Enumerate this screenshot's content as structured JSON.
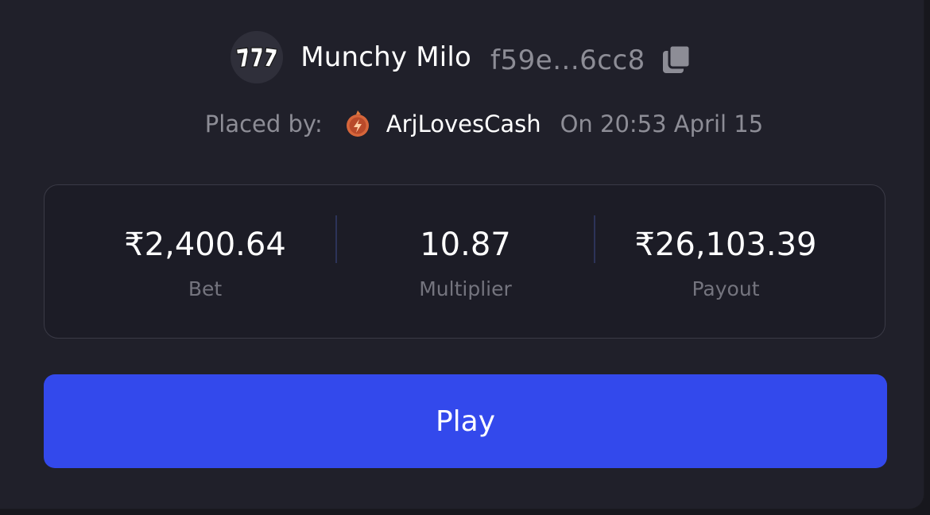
{
  "game": {
    "name": "Munchy Milo",
    "hash": "f59e...6cc8",
    "icon": "slot-777-icon"
  },
  "placed": {
    "label": "Placed by:",
    "username": "ArjLovesCash",
    "user_icon": "lightning-badge-icon",
    "timestamp": "On 20:53 April 15"
  },
  "stats": {
    "bet": {
      "value": "₹2,400.64",
      "label": "Bet"
    },
    "multiplier": {
      "value": "10.87",
      "label": "Multiplier"
    },
    "payout": {
      "value": "₹26,103.39",
      "label": "Payout"
    }
  },
  "actions": {
    "play_label": "Play"
  },
  "colors": {
    "background": "#20202a",
    "accent": "#3349ec",
    "muted_text": "#8d8d96"
  }
}
